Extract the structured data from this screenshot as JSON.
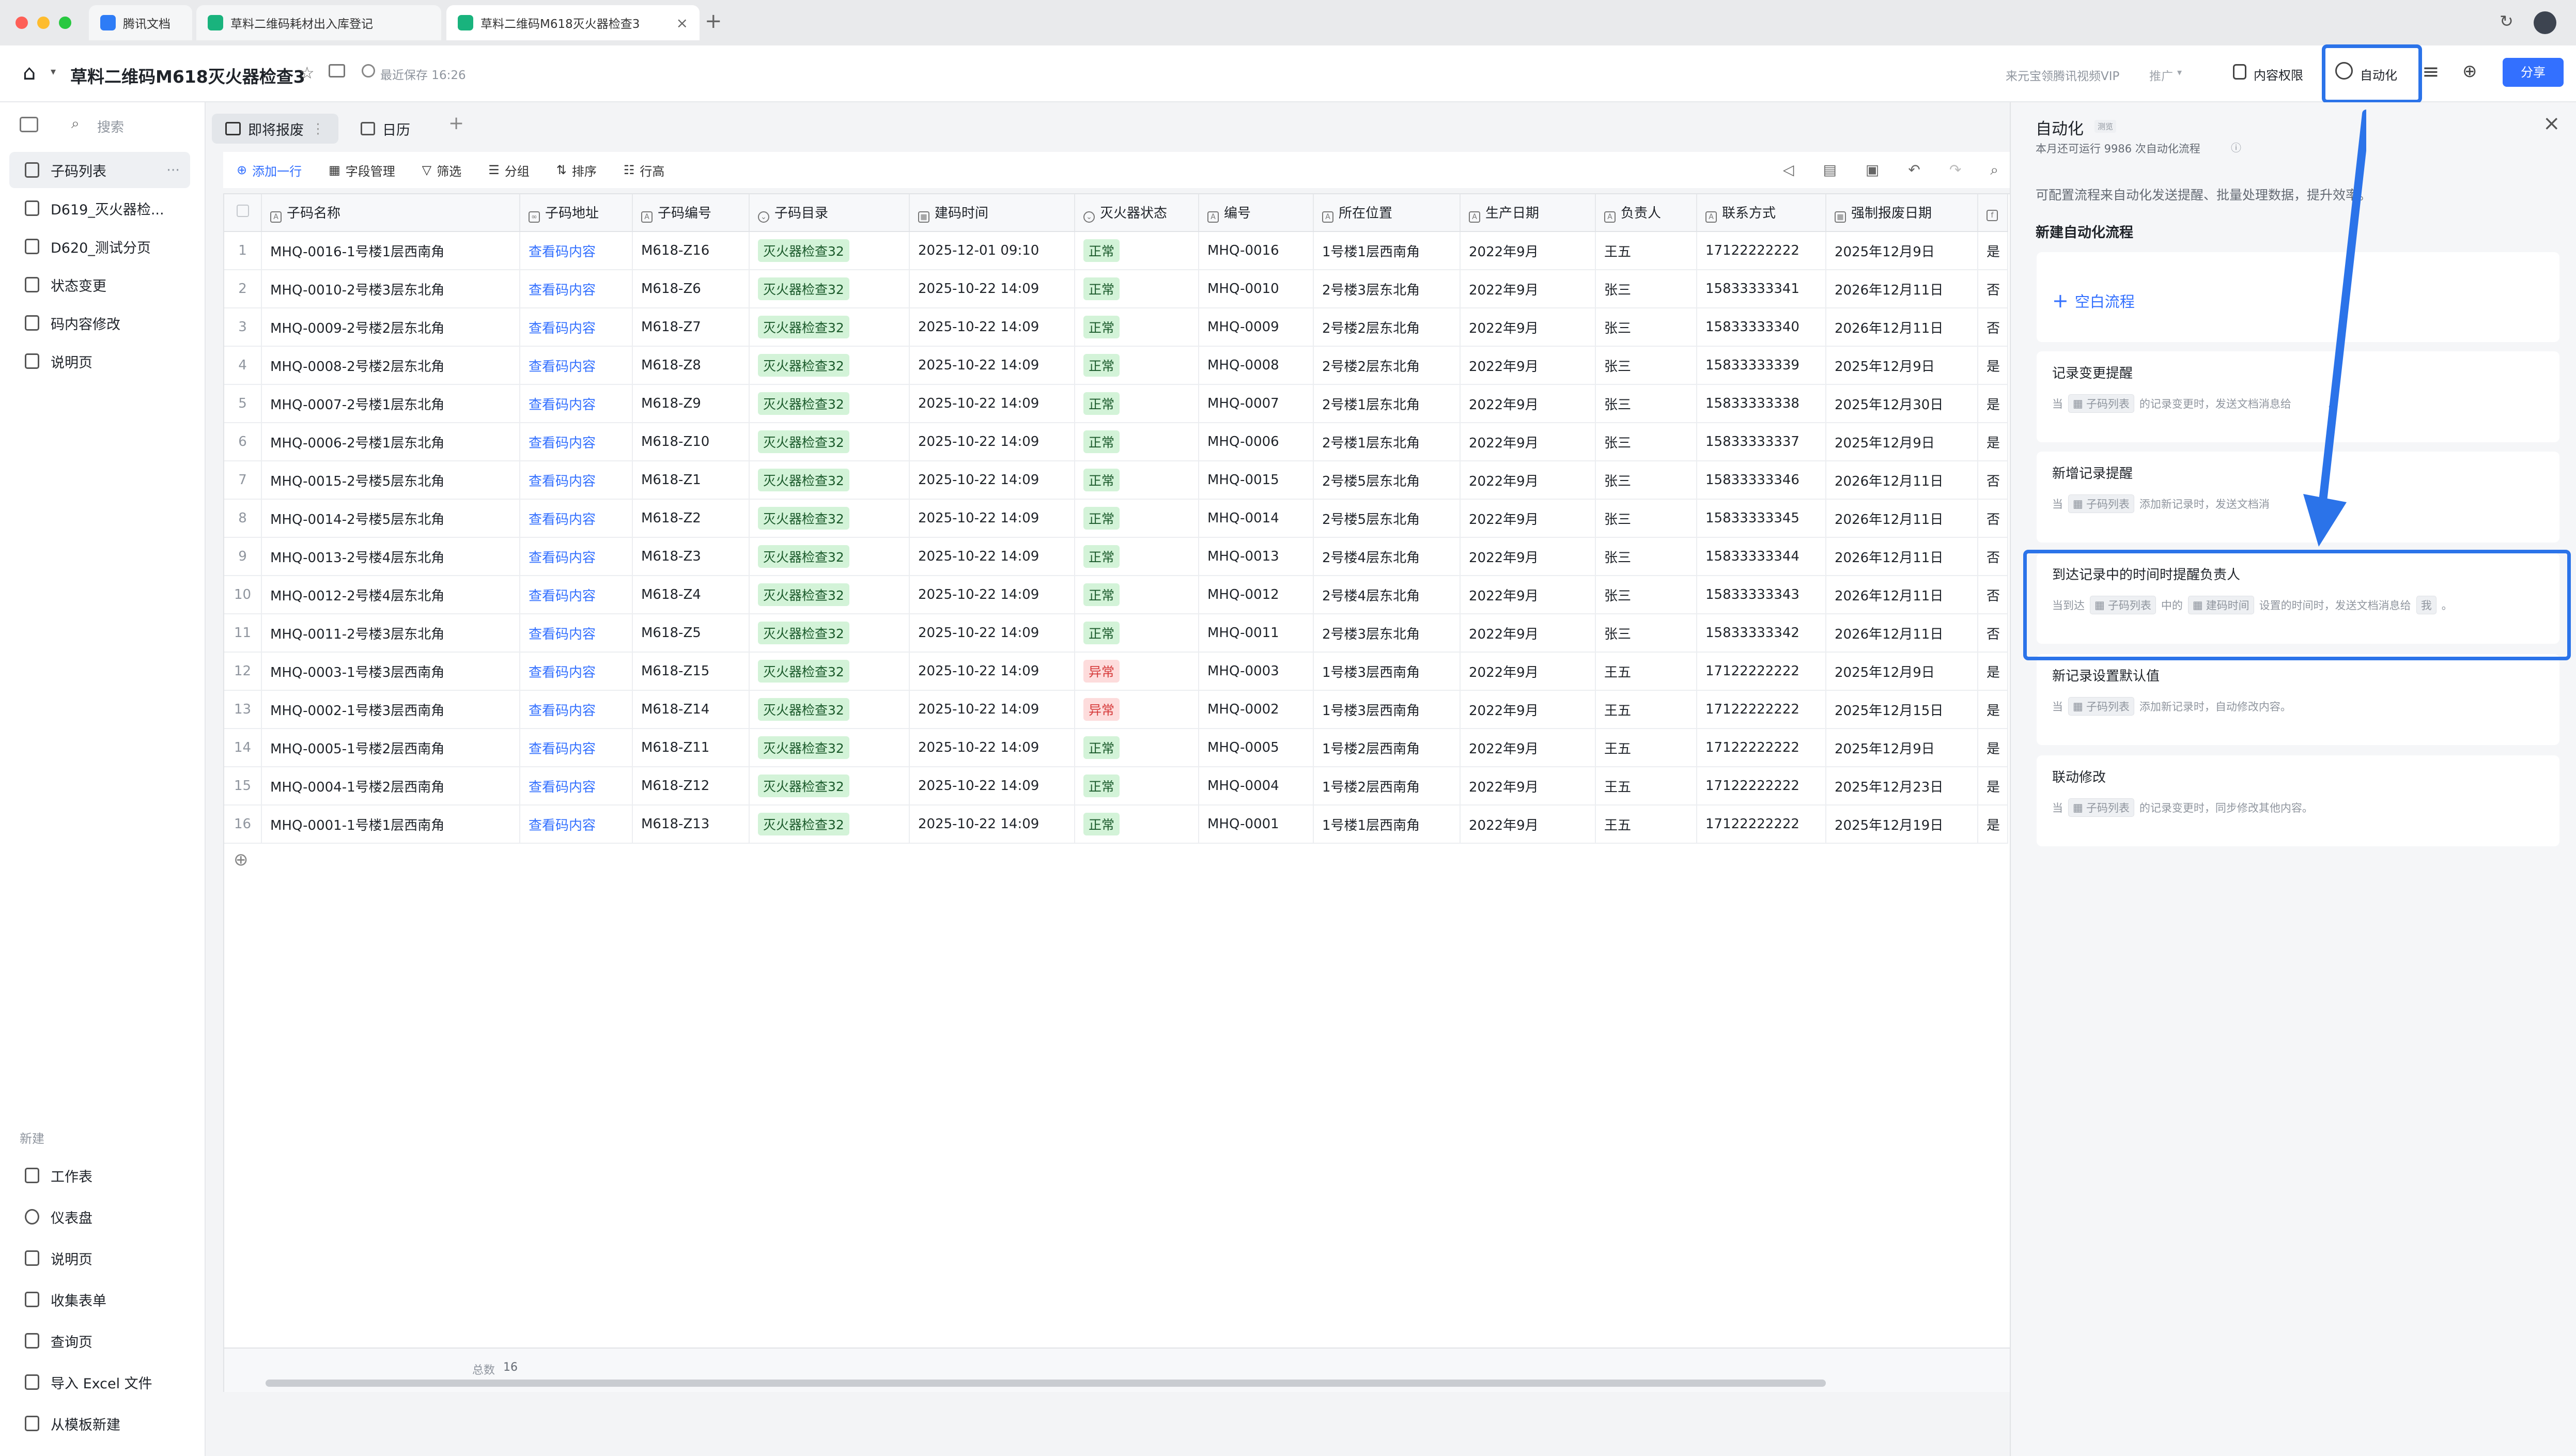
{
  "browser": {
    "tabs": [
      {
        "label": "腾讯文档"
      },
      {
        "label": "草料二维码耗材出入库登记"
      },
      {
        "label": "草料二维码M618灭火器检查3"
      }
    ]
  },
  "header": {
    "title": "草料二维码M618灭火器检查3",
    "save_status": "最近保存 16:26",
    "vip_text": "来元宝领腾讯视频VIP",
    "promo": "推广",
    "permission": "内容权限",
    "automation": "自动化",
    "share": "分享"
  },
  "sidebar": {
    "search": "搜索",
    "items": [
      {
        "label": "子码列表"
      },
      {
        "label": "D619_灭火器检..."
      },
      {
        "label": "D620_测试分页"
      },
      {
        "label": "状态变更"
      },
      {
        "label": "码内容修改"
      },
      {
        "label": "说明页"
      }
    ],
    "new_section": "新建",
    "new_items": [
      {
        "label": "工作表"
      },
      {
        "label": "仪表盘"
      },
      {
        "label": "说明页"
      },
      {
        "label": "收集表单"
      },
      {
        "label": "查询页"
      },
      {
        "label": "导入 Excel 文件"
      },
      {
        "label": "从模板新建"
      }
    ]
  },
  "views": [
    {
      "label": "即将报废"
    },
    {
      "label": "日历"
    }
  ],
  "toolbar": {
    "add_row": "添加一行",
    "fields": "字段管理",
    "filter": "筛选",
    "group": "分组",
    "sort": "排序",
    "row_height": "行高"
  },
  "table": {
    "columns": [
      "子码名称",
      "子码地址",
      "子码编号",
      "子码目录",
      "建码时间",
      "灭火器状态",
      "编号",
      "所在位置",
      "生产日期",
      "负责人",
      "联系方式",
      "强制报废日期",
      ""
    ],
    "rows": [
      [
        "1",
        "MHQ-0016-1号楼1层西南角",
        "查看码内容",
        "M618-Z16",
        "灭火器检查32",
        "2025-12-01 09:10",
        "正常",
        "MHQ-0016",
        "1号楼1层西南角",
        "2022年9月",
        "王五",
        "17122222222",
        "2025年12月9日",
        "是"
      ],
      [
        "2",
        "MHQ-0010-2号楼3层东北角",
        "查看码内容",
        "M618-Z6",
        "灭火器检查32",
        "2025-10-22 14:09",
        "正常",
        "MHQ-0010",
        "2号楼3层东北角",
        "2022年9月",
        "张三",
        "15833333341",
        "2026年12月11日",
        "否"
      ],
      [
        "3",
        "MHQ-0009-2号楼2层东北角",
        "查看码内容",
        "M618-Z7",
        "灭火器检查32",
        "2025-10-22 14:09",
        "正常",
        "MHQ-0009",
        "2号楼2层东北角",
        "2022年9月",
        "张三",
        "15833333340",
        "2026年12月11日",
        "否"
      ],
      [
        "4",
        "MHQ-0008-2号楼2层东北角",
        "查看码内容",
        "M618-Z8",
        "灭火器检查32",
        "2025-10-22 14:09",
        "正常",
        "MHQ-0008",
        "2号楼2层东北角",
        "2022年9月",
        "张三",
        "15833333339",
        "2025年12月9日",
        "是"
      ],
      [
        "5",
        "MHQ-0007-2号楼1层东北角",
        "查看码内容",
        "M618-Z9",
        "灭火器检查32",
        "2025-10-22 14:09",
        "正常",
        "MHQ-0007",
        "2号楼1层东北角",
        "2022年9月",
        "张三",
        "15833333338",
        "2025年12月30日",
        "是"
      ],
      [
        "6",
        "MHQ-0006-2号楼1层东北角",
        "查看码内容",
        "M618-Z10",
        "灭火器检查32",
        "2025-10-22 14:09",
        "正常",
        "MHQ-0006",
        "2号楼1层东北角",
        "2022年9月",
        "张三",
        "15833333337",
        "2025年12月9日",
        "是"
      ],
      [
        "7",
        "MHQ-0015-2号楼5层东北角",
        "查看码内容",
        "M618-Z1",
        "灭火器检查32",
        "2025-10-22 14:09",
        "正常",
        "MHQ-0015",
        "2号楼5层东北角",
        "2022年9月",
        "张三",
        "15833333346",
        "2026年12月11日",
        "否"
      ],
      [
        "8",
        "MHQ-0014-2号楼5层东北角",
        "查看码内容",
        "M618-Z2",
        "灭火器检查32",
        "2025-10-22 14:09",
        "正常",
        "MHQ-0014",
        "2号楼5层东北角",
        "2022年9月",
        "张三",
        "15833333345",
        "2026年12月11日",
        "否"
      ],
      [
        "9",
        "MHQ-0013-2号楼4层东北角",
        "查看码内容",
        "M618-Z3",
        "灭火器检查32",
        "2025-10-22 14:09",
        "正常",
        "MHQ-0013",
        "2号楼4层东北角",
        "2022年9月",
        "张三",
        "15833333344",
        "2026年12月11日",
        "否"
      ],
      [
        "10",
        "MHQ-0012-2号楼4层东北角",
        "查看码内容",
        "M618-Z4",
        "灭火器检查32",
        "2025-10-22 14:09",
        "正常",
        "MHQ-0012",
        "2号楼4层东北角",
        "2022年9月",
        "张三",
        "15833333343",
        "2026年12月11日",
        "否"
      ],
      [
        "11",
        "MHQ-0011-2号楼3层东北角",
        "查看码内容",
        "M618-Z5",
        "灭火器检查32",
        "2025-10-22 14:09",
        "正常",
        "MHQ-0011",
        "2号楼3层东北角",
        "2022年9月",
        "张三",
        "15833333342",
        "2026年12月11日",
        "否"
      ],
      [
        "12",
        "MHQ-0003-1号楼3层西南角",
        "查看码内容",
        "M618-Z15",
        "灭火器检查32",
        "2025-10-22 14:09",
        "异常",
        "MHQ-0003",
        "1号楼3层西南角",
        "2022年9月",
        "王五",
        "17122222222",
        "2025年12月9日",
        "是"
      ],
      [
        "13",
        "MHQ-0002-1号楼3层西南角",
        "查看码内容",
        "M618-Z14",
        "灭火器检查32",
        "2025-10-22 14:09",
        "异常",
        "MHQ-0002",
        "1号楼3层西南角",
        "2022年9月",
        "王五",
        "17122222222",
        "2025年12月15日",
        "是"
      ],
      [
        "14",
        "MHQ-0005-1号楼2层西南角",
        "查看码内容",
        "M618-Z11",
        "灭火器检查32",
        "2025-10-22 14:09",
        "正常",
        "MHQ-0005",
        "1号楼2层西南角",
        "2022年9月",
        "王五",
        "17122222222",
        "2025年12月9日",
        "是"
      ],
      [
        "15",
        "MHQ-0004-1号楼2层西南角",
        "查看码内容",
        "M618-Z12",
        "灭火器检查32",
        "2025-10-22 14:09",
        "正常",
        "MHQ-0004",
        "1号楼2层西南角",
        "2022年9月",
        "王五",
        "17122222222",
        "2025年12月23日",
        "是"
      ],
      [
        "16",
        "MHQ-0001-1号楼1层西南角",
        "查看码内容",
        "M618-Z13",
        "灭火器检查32",
        "2025-10-22 14:09",
        "正常",
        "MHQ-0001",
        "1号楼1层西南角",
        "2022年9月",
        "王五",
        "17122222222",
        "2025年12月19日",
        "是"
      ]
    ],
    "footer_label": "总数",
    "footer_count": "16"
  },
  "panel": {
    "title": "自动化",
    "badge": "测览",
    "quota": "本月还可运行 9986 次自动化流程",
    "intro": "可配置流程来自动化发送提醒、批量处理数据，提升效率。",
    "new_flow": "新建自动化流程",
    "blank_flow": "空白流程",
    "cards": [
      {
        "title": "记录变更提醒",
        "d1": "当",
        "chip1": "子码列表",
        "d2": "的记录变更时，发送文档消息给",
        "d3": "。"
      },
      {
        "title": "新增记录提醒",
        "d1": "当",
        "chip1": "子码列表",
        "d2": "添加新记录时，发送文档消",
        "d3": ""
      },
      {
        "title": "到达记录中的时间时提醒负责人",
        "d1": "当到达",
        "chip1": "子码列表",
        "d2": "中的",
        "chip2": "建码时间",
        "d3": "设置的时间时，发送文档消息给",
        "chip3": "我",
        "d4": "。"
      },
      {
        "title": "新记录设置默认值",
        "d1": "当",
        "chip1": "子码列表",
        "d2": "添加新记录时，自动修改内容。"
      },
      {
        "title": "联动修改",
        "d1": "当",
        "chip1": "子码列表",
        "d2": "的记录变更时，同步修改其他内容。"
      }
    ]
  },
  "colors": {
    "accent": "#3370ff",
    "highlight": "#2b73e9",
    "ok_bg": "#d3f3d8",
    "bad_bg": "#fddcdc"
  }
}
